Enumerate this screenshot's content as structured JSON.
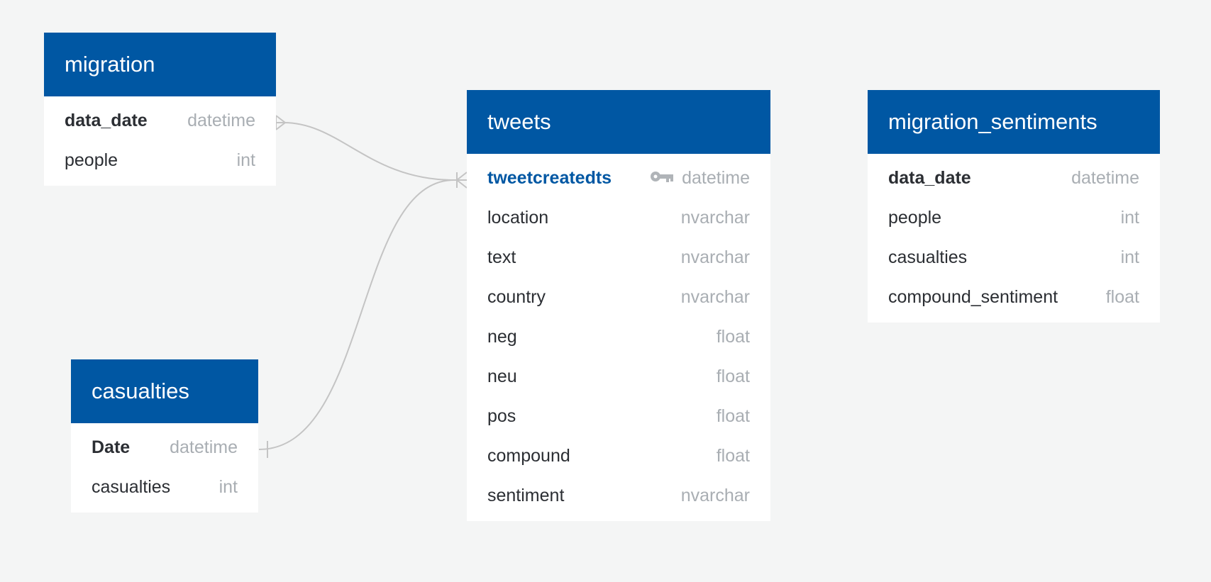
{
  "tables": {
    "migration": {
      "title": "migration",
      "fields": [
        {
          "name": "data_date",
          "type": "datetime"
        },
        {
          "name": "people",
          "type": "int"
        }
      ]
    },
    "casualties": {
      "title": "casualties",
      "fields": [
        {
          "name": "Date",
          "type": "datetime"
        },
        {
          "name": "casualties",
          "type": "int"
        }
      ]
    },
    "tweets": {
      "title": "tweets",
      "fields": [
        {
          "name": "tweetcreatedts",
          "type": "datetime"
        },
        {
          "name": "location",
          "type": "nvarchar"
        },
        {
          "name": "text",
          "type": "nvarchar"
        },
        {
          "name": "country",
          "type": "nvarchar"
        },
        {
          "name": "neg",
          "type": "float"
        },
        {
          "name": "neu",
          "type": "float"
        },
        {
          "name": "pos",
          "type": "float"
        },
        {
          "name": "compound",
          "type": "float"
        },
        {
          "name": "sentiment",
          "type": "nvarchar"
        }
      ]
    },
    "migration_sentiments": {
      "title": "migration_sentiments",
      "fields": [
        {
          "name": "data_date",
          "type": "datetime"
        },
        {
          "name": "people",
          "type": "int"
        },
        {
          "name": "casualties",
          "type": "int"
        },
        {
          "name": "compound_sentiment",
          "type": "float"
        }
      ]
    }
  },
  "colors": {
    "header": "#0057a3",
    "background": "#f4f5f5",
    "type_text": "#a9aeb3",
    "link": "#c4c4c4"
  },
  "icons": {
    "primary_key": "key-icon"
  }
}
